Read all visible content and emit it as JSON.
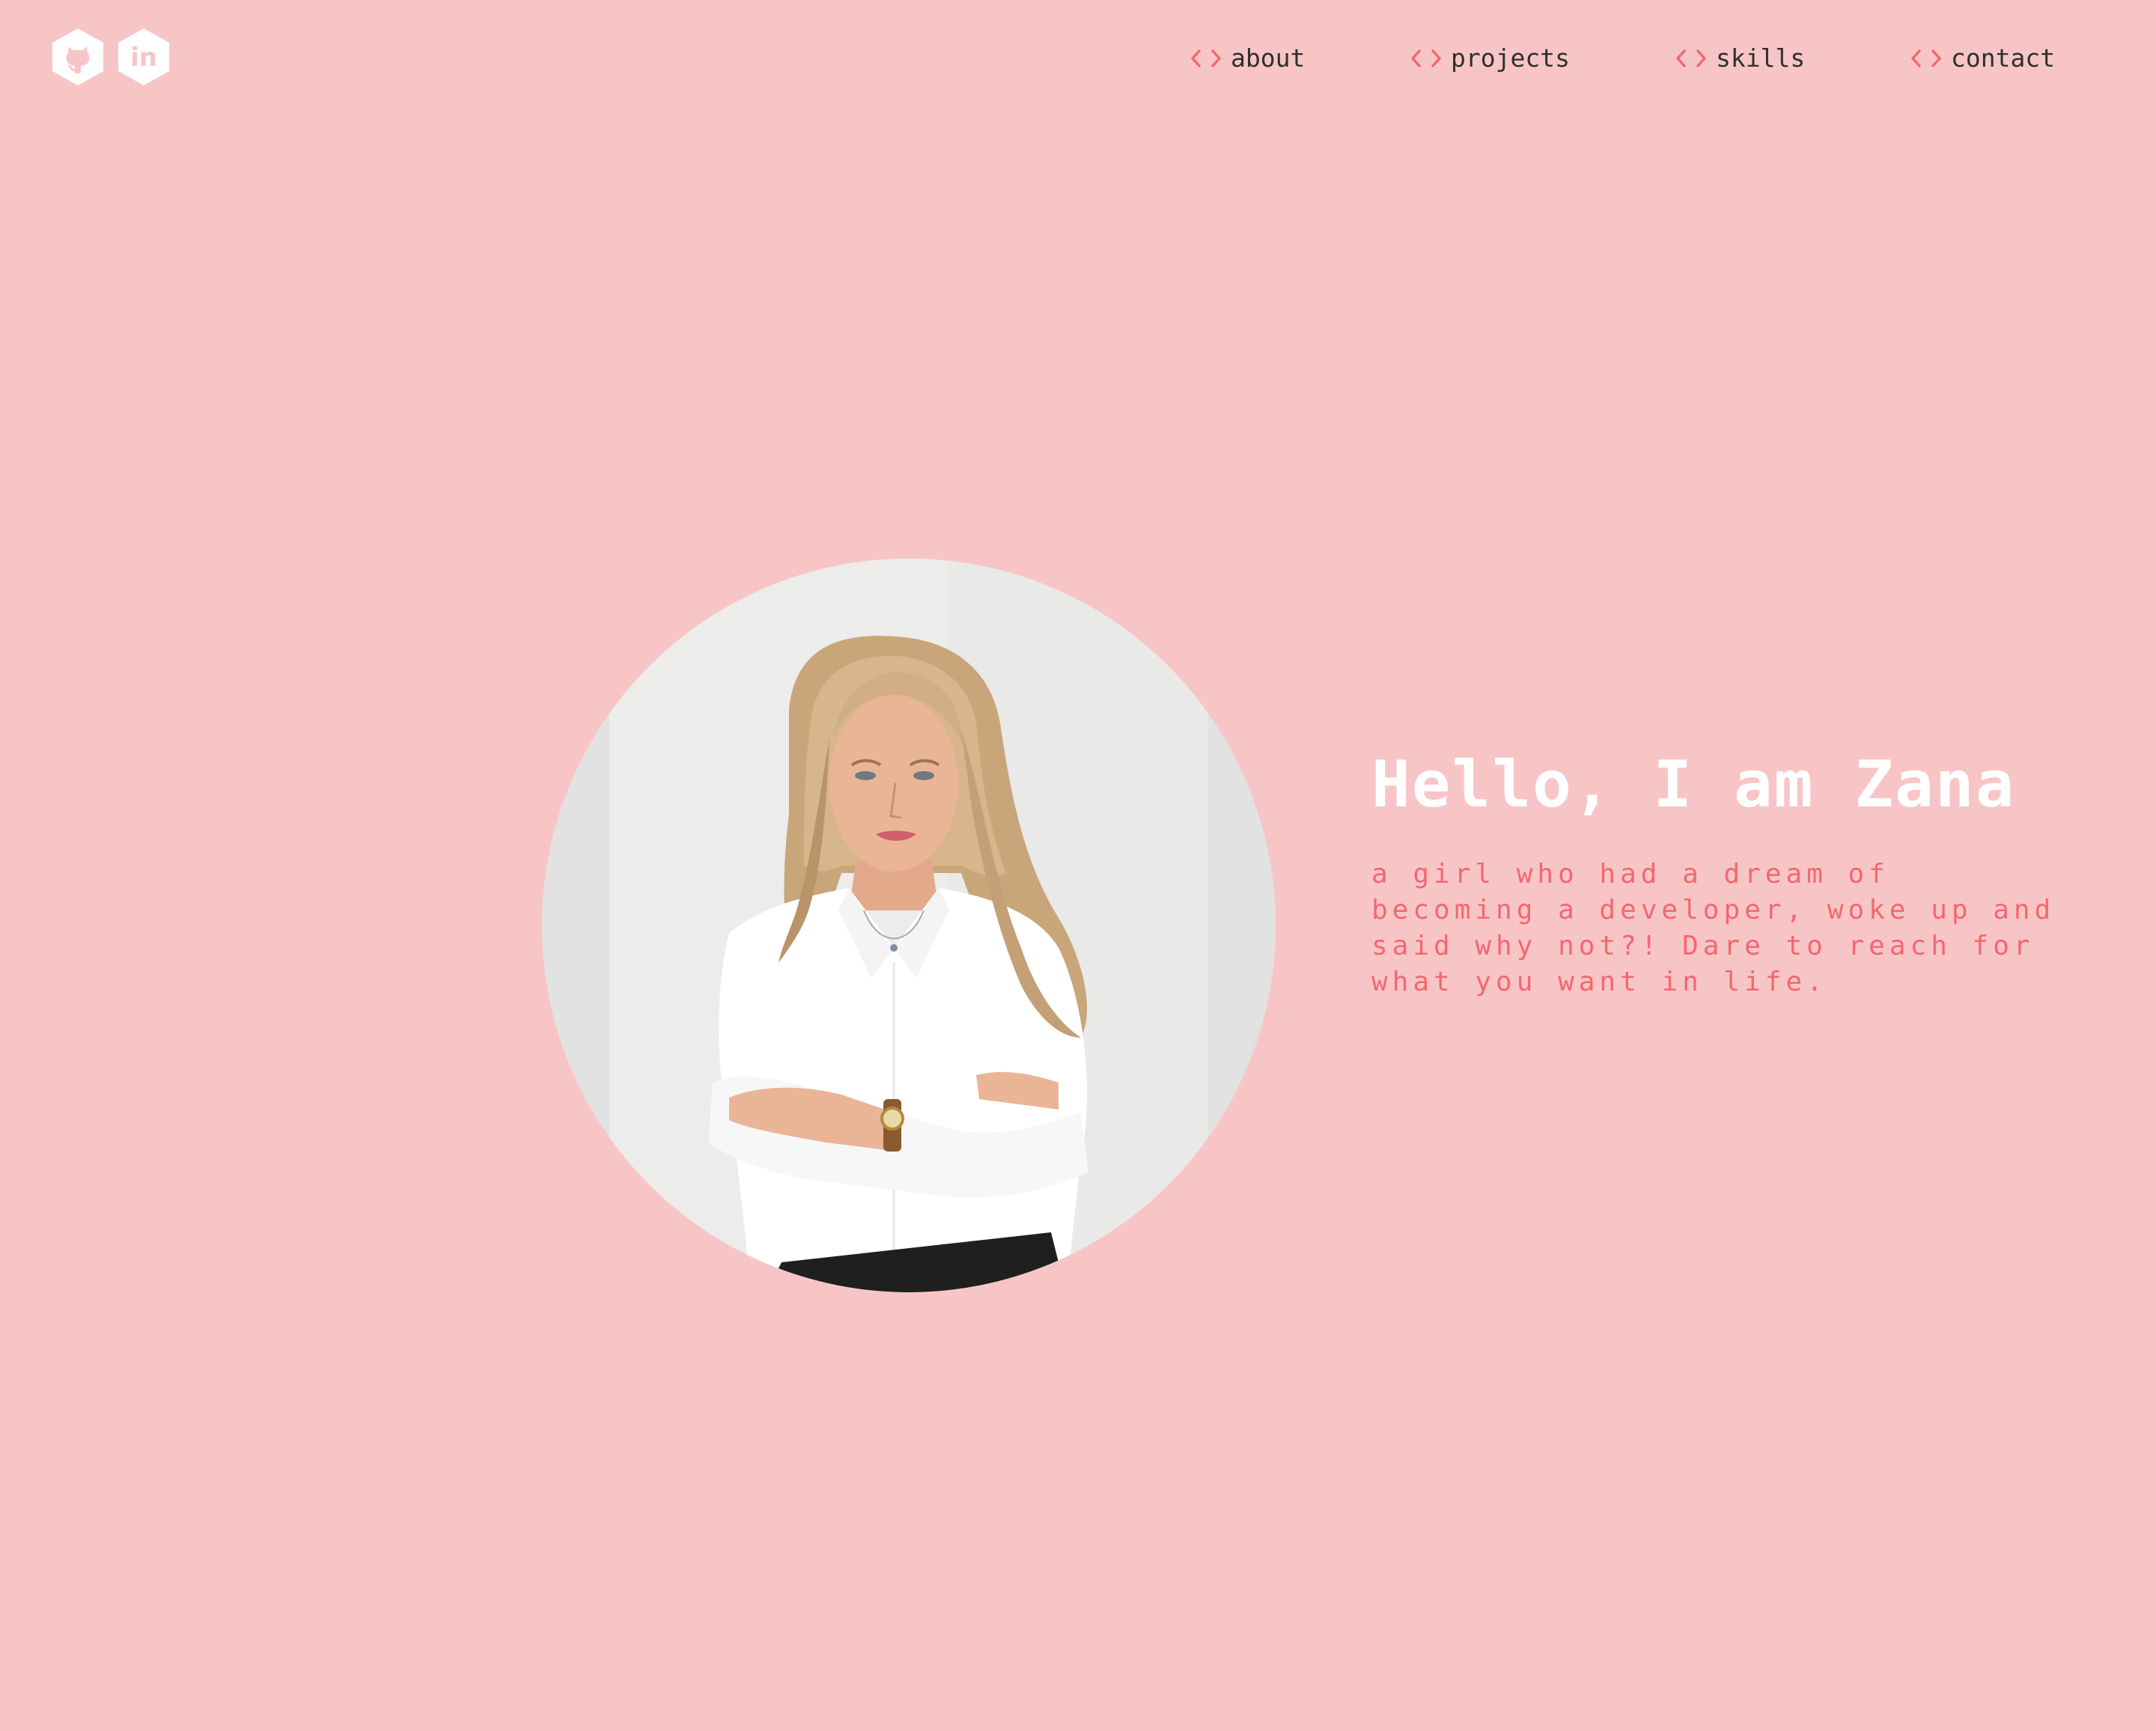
{
  "social": {
    "github_icon": "github-icon",
    "linkedin_icon": "linkedin-icon",
    "linkedin_glyph": "in"
  },
  "nav": {
    "items": [
      {
        "label": "about"
      },
      {
        "label": "projects"
      },
      {
        "label": "skills"
      },
      {
        "label": "contact"
      }
    ],
    "icon": "code-brackets-icon"
  },
  "hero": {
    "title": "Hello, I am Zana",
    "subtitle": "a girl who had a dream of becoming a developer, woke up and said why not?! Dare to reach for what you want in life."
  },
  "colors": {
    "background": "#f8c5c6",
    "accent": "#f3686f",
    "title": "#ffffff",
    "nav_text": "#2f2f2f"
  }
}
